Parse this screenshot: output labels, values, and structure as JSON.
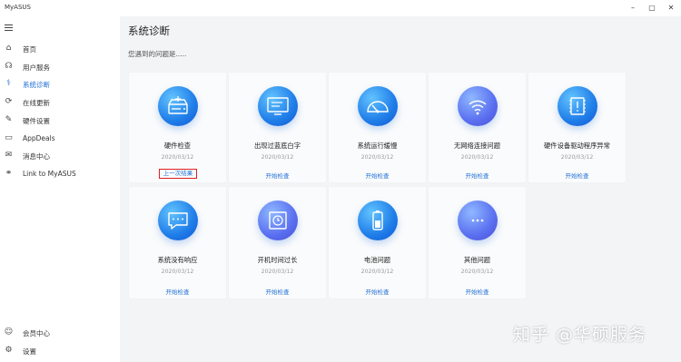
{
  "window": {
    "title": "MyASUS",
    "minimize_glyph": "–",
    "maximize_glyph": "▢",
    "close_glyph": "✕"
  },
  "sidebar": {
    "items": [
      {
        "label": "首页",
        "icon": "home-icon",
        "glyph": "⌂"
      },
      {
        "label": "用户服务",
        "icon": "headset-icon",
        "glyph": "☊"
      },
      {
        "label": "系统诊断",
        "icon": "stethoscope-icon",
        "glyph": "⚕",
        "active": true
      },
      {
        "label": "在线更新",
        "icon": "update-icon",
        "glyph": "⟳"
      },
      {
        "label": "硬件设置",
        "icon": "wrench-icon",
        "glyph": "✎"
      },
      {
        "label": "AppDeals",
        "icon": "appdeals-icon",
        "glyph": "▭"
      },
      {
        "label": "消息中心",
        "icon": "message-icon",
        "glyph": "✉"
      },
      {
        "label": "Link to MyASUS",
        "icon": "link-icon",
        "glyph": "⚭"
      }
    ],
    "bottom_items": [
      {
        "label": "会员中心",
        "icon": "user-icon",
        "glyph": "☺"
      },
      {
        "label": "设置",
        "icon": "gear-icon",
        "glyph": "⚙"
      }
    ]
  },
  "main": {
    "title": "系统诊断",
    "subtitle": "您遇到的问题是.....",
    "cards": [
      {
        "name": "硬件检查",
        "date": "2020/03/12",
        "action": "上一次结果",
        "icon": "hardware-check-icon",
        "highlighted": true
      },
      {
        "name": "出现过蓝底白字",
        "date": "2020/03/12",
        "action": "开始检查",
        "icon": "monitor-icon"
      },
      {
        "name": "系统运行缓慢",
        "date": "2020/03/12",
        "action": "开始检查",
        "icon": "speedometer-icon"
      },
      {
        "name": "无网络连接问题",
        "date": "2020/03/12",
        "action": "开始检查",
        "icon": "wifi-icon"
      },
      {
        "name": "硬件设备驱动程序异常",
        "date": "2020/03/12",
        "action": "开始检查",
        "icon": "driver-chip-icon"
      },
      {
        "name": "系统没有响应",
        "date": "2020/03/12",
        "action": "开始检查",
        "icon": "chat-bubble-icon"
      },
      {
        "name": "开机时间过长",
        "date": "2020/03/12",
        "action": "开始检查",
        "icon": "boot-time-icon"
      },
      {
        "name": "电池问题",
        "date": "2020/03/12",
        "action": "开始检查",
        "icon": "battery-icon"
      },
      {
        "name": "其他问题",
        "date": "2020/03/12",
        "action": "开始检查",
        "icon": "more-dots-icon"
      }
    ]
  },
  "watermark": {
    "text": "知乎 @华硕服务"
  },
  "colors": {
    "accent": "#1f6fd6",
    "highlight_border": "#e02020"
  }
}
